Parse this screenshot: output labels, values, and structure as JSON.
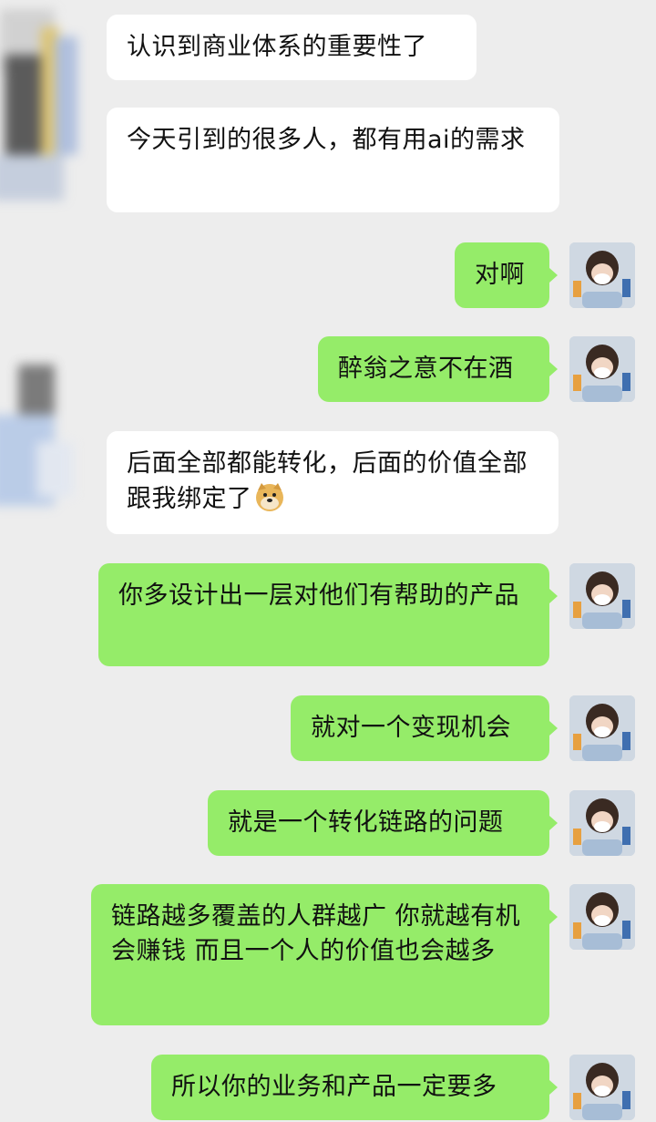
{
  "messages": [
    {
      "side": "in",
      "text": "认识到商业体系的重要性了"
    },
    {
      "side": "in",
      "text": "今天引到的很多人，都有用ai的需求"
    },
    {
      "side": "out",
      "text": "对啊"
    },
    {
      "side": "out",
      "text": "醉翁之意不在酒"
    },
    {
      "side": "in",
      "text": "后面全部都能转化，后面的价值全部跟我绑定了",
      "emoji": "doge-emoji"
    },
    {
      "side": "out",
      "text": "你多设计出一层对他们有帮助的产品"
    },
    {
      "side": "out",
      "text": "就对一个变现机会"
    },
    {
      "side": "out",
      "text": "就是一个转化链路的问题"
    },
    {
      "side": "out",
      "text": "链路越多覆盖的人群越广 你就越有机会赚钱 而且一个人的价值也会越多"
    },
    {
      "side": "out",
      "text": "所以你的业务和产品一定要多"
    }
  ],
  "colors": {
    "background": "#ededed",
    "incoming": "#ffffff",
    "outgoing": "#95ec69"
  },
  "icons": {
    "avatar": "user-avatar-icon",
    "emoji": "doge-emoji"
  }
}
